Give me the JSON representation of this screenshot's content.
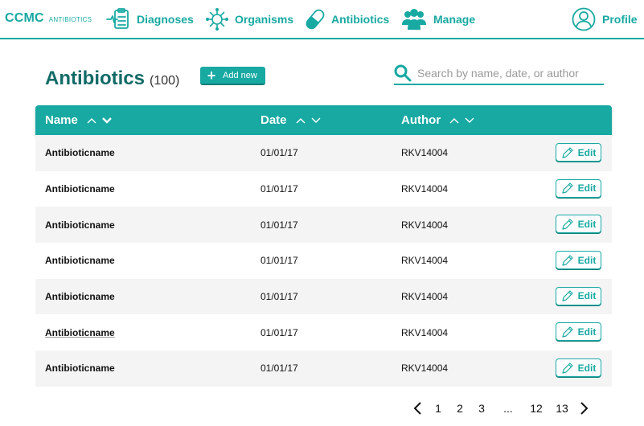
{
  "brand": {
    "main": "CCMC",
    "sub": "ANTIBIOTICS"
  },
  "nav": {
    "diagnoses": "Diagnoses",
    "organisms": "Organisms",
    "antibiotics": "Antibiotics",
    "manage": "Manage",
    "profile": "Profile"
  },
  "header": {
    "title": "Antibiotics",
    "count": "(100)",
    "add_label": "Add new"
  },
  "search": {
    "placeholder": "Search by name, date, or author",
    "value": ""
  },
  "table": {
    "columns": {
      "name": "Name",
      "date": "Date",
      "author": "Author"
    },
    "edit_label": "Edit",
    "rows": [
      {
        "name": "Antibioticname",
        "date": "01/01/17",
        "author": "RKV14004"
      },
      {
        "name": "Antibioticname",
        "date": "01/01/17",
        "author": "RKV14004"
      },
      {
        "name": "Antibioticname",
        "date": "01/01/17",
        "author": "RKV14004"
      },
      {
        "name": "Antibioticname",
        "date": "01/01/17",
        "author": "RKV14004"
      },
      {
        "name": "Antibioticname",
        "date": "01/01/17",
        "author": "RKV14004"
      },
      {
        "name": "Antibioticname",
        "date": "01/01/17",
        "author": "RKV14004"
      },
      {
        "name": "Antibioticname",
        "date": "01/01/17",
        "author": "RKV14004"
      }
    ]
  },
  "pagination": {
    "pages": [
      "1",
      "2",
      "3",
      "...",
      "12",
      "13"
    ]
  },
  "colors": {
    "accent": "#17a9a2",
    "title": "#116b67",
    "row_alt": "#f4f4f5"
  },
  "icons": {
    "diagnoses": "clipboard-pulse-icon",
    "organisms": "virus-icon",
    "antibiotics": "pill-icon",
    "manage": "users-icon",
    "profile": "user-circle-icon",
    "search": "search-icon",
    "add": "plus-icon",
    "edit": "pencil-icon",
    "sort_asc": "chevron-up-icon",
    "sort_desc": "chevron-down-icon",
    "prev": "chevron-left-icon",
    "next": "chevron-right-icon"
  }
}
